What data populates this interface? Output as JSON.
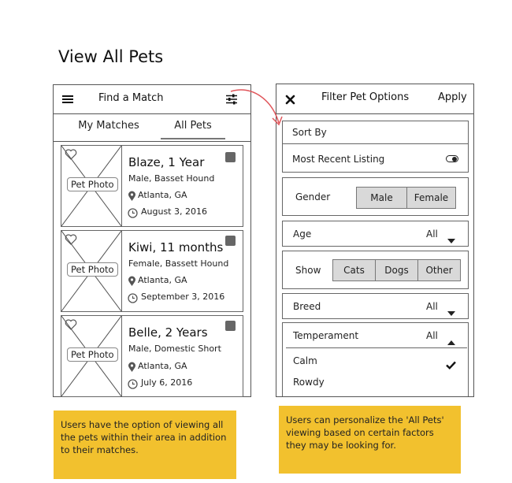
{
  "page_title": "View All Pets",
  "left_panel": {
    "header_title": "Find a Match",
    "tabs": [
      "My Matches",
      "All Pets"
    ],
    "active_tab": "All Pets",
    "photo_label": "Pet Photo",
    "pets": [
      {
        "name": "Blaze, 1 Year",
        "breed": "Male, Basset Hound",
        "location": "Atlanta, GA",
        "date": "August 3, 2016"
      },
      {
        "name": "Kiwi, 11 months",
        "breed": "Female, Bassett Hound",
        "location": "Atlanta, GA",
        "date": "September 3, 2016"
      },
      {
        "name": "Belle, 2 Years",
        "breed": "Male, Domestic Short",
        "location": "Atlanta, GA",
        "date": "July 6, 2016"
      }
    ]
  },
  "right_panel": {
    "header_title": "Filter Pet Options",
    "apply_label": "Apply",
    "sort_by_label": "Sort By",
    "most_recent_label": "Most Recent Listing",
    "gender_label": "Gender",
    "gender_options": [
      "Male",
      "Female"
    ],
    "age_label": "Age",
    "age_value": "All",
    "show_label": "Show",
    "show_options": [
      "Cats",
      "Dogs",
      "Other"
    ],
    "breed_label": "Breed",
    "breed_value": "All",
    "temperament_label": "Temperament",
    "temperament_value": "All",
    "temperament_options": [
      "Calm",
      "Rowdy"
    ]
  },
  "notes": {
    "left": "Users have the option of viewing all the pets within their area in addition to their matches.",
    "right": "Users can personalize the 'All Pets' viewing based on certain factors they may be looking for."
  },
  "colors": {
    "note_bg": "#f2c12e",
    "arrow": "#e0565b",
    "segment_bg": "#d9d9d9"
  },
  "icons": [
    "menu-icon",
    "sliders-icon",
    "close-icon",
    "location-pin-icon",
    "clock-icon",
    "heart-icon",
    "chevron-down-icon",
    "chevron-up-icon",
    "checkmark-icon",
    "toggle-icon"
  ]
}
